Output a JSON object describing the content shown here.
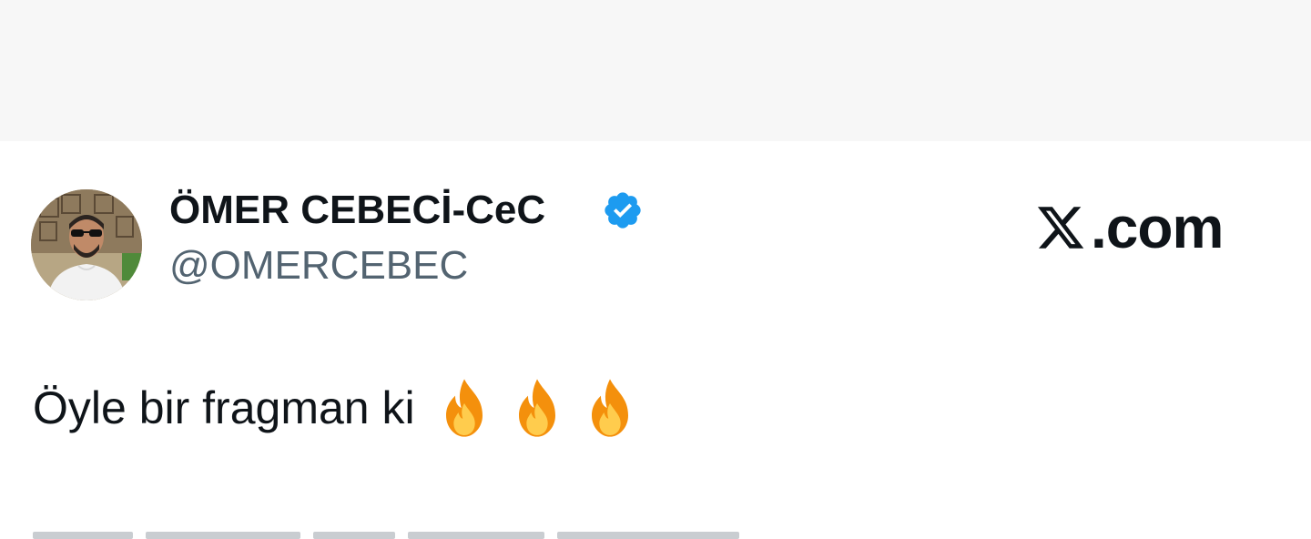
{
  "author": {
    "display_name": "ÖMER CEBECİ-CeC",
    "handle": "@OMERCEBEC",
    "verified": true
  },
  "brand": {
    "text": ".com",
    "logo": "x-logo"
  },
  "tweet": {
    "text": "Öyle bir fragman ki",
    "emojis": [
      "fire-emoji",
      "fire-emoji",
      "fire-emoji"
    ]
  },
  "colors": {
    "text_primary": "#0f1419",
    "text_secondary": "#536471",
    "verified_blue": "#1d9bf0",
    "top_band": "#f7f7f7"
  }
}
